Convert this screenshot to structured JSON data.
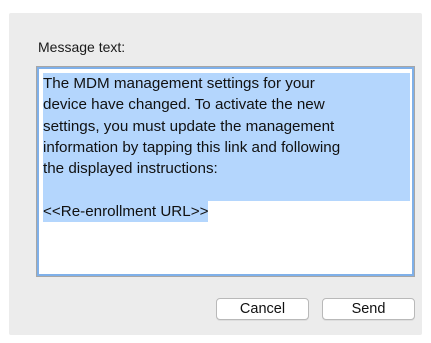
{
  "dialog": {
    "label": "Message text:",
    "message_lines": [
      "The MDM management settings for your",
      "device have changed. To activate the new",
      "settings, you must update the management",
      "information by tapping this link and following",
      "the displayed instructions:",
      "",
      "<<Re-enrollment URL>>"
    ],
    "cancel_label": "Cancel",
    "send_label": "Send"
  },
  "colors": {
    "selection": "#b4d6fd",
    "focus_ring": "#7fb0e9",
    "sheet_background": "#ececec"
  }
}
